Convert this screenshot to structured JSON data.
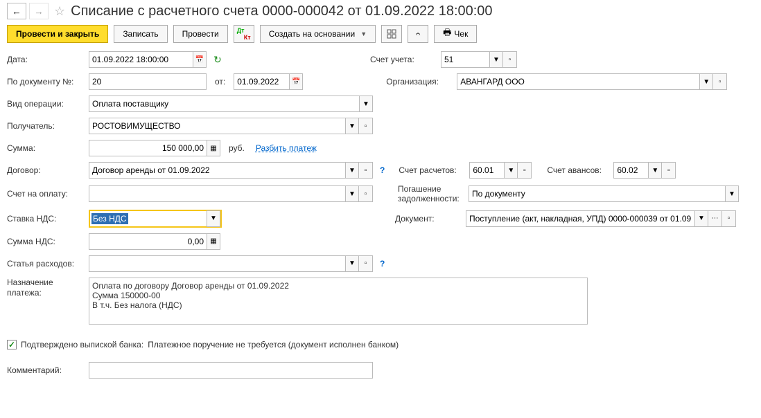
{
  "header": {
    "title": "Списание с расчетного счета 0000-000042 от 01.09.2022 18:00:00"
  },
  "toolbar": {
    "post_close": "Провести и закрыть",
    "save": "Записать",
    "post": "Провести",
    "create_based": "Создать на основании",
    "cheque": "Чек"
  },
  "labels": {
    "date": "Дата:",
    "doc_no": "По документу №:",
    "from": "от:",
    "op_type": "Вид операции:",
    "recipient": "Получатель:",
    "sum": "Сумма:",
    "contract": "Договор:",
    "pay_account": "Счет на оплату:",
    "vat_rate": "Ставка НДС:",
    "vat_sum": "Сумма НДС:",
    "expense_item": "Статья расходов:",
    "purpose": "Назначение платежа:",
    "account": "Счет учета:",
    "org": "Организация:",
    "calc_acc": "Счет расчетов:",
    "adv_acc": "Счет авансов:",
    "debt": "Погашение задолженности:",
    "document": "Документ:",
    "confirmed": "Подтверждено выпиской банка:",
    "confirmed_txt": "Платежное поручение не требуется (документ исполнен банком)",
    "comment": "Комментарий:",
    "rub": "руб.",
    "split": "Разбить платеж"
  },
  "values": {
    "date": "01.09.2022 18:00:00",
    "doc_no": "20",
    "doc_date": "01.09.2022",
    "op_type": "Оплата поставщику",
    "recipient": "РОСТОВИМУЩЕСТВО",
    "sum": "150 000,00",
    "contract": "Договор аренды от 01.09.2022",
    "pay_account": "",
    "vat_rate": "Без НДС",
    "vat_sum": "0,00",
    "expense_item": "",
    "purpose": "Оплата по договору Договор аренды от 01.09.2022\nСумма 150000-00\nВ т.ч. Без налога (НДС)",
    "account": "51",
    "org": "АВАНГАРД ООО",
    "calc_acc": "60.01",
    "adv_acc": "60.02",
    "debt": "По документу",
    "document": "Поступление (акт, накладная, УПД) 0000-000039 от 01.09",
    "comment": ""
  }
}
